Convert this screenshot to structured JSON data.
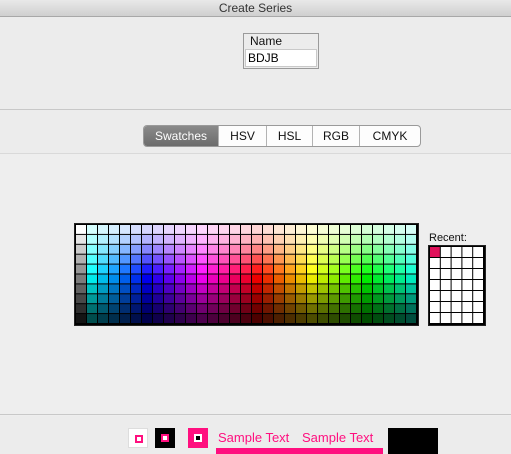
{
  "window": {
    "title": "Create Series"
  },
  "name_field": {
    "legend": "Name",
    "value": "BDJB"
  },
  "tabs": [
    {
      "label": "Swatches",
      "selected": true
    },
    {
      "label": "HSV",
      "selected": false
    },
    {
      "label": "HSL",
      "selected": false
    },
    {
      "label": "RGB",
      "selected": false
    },
    {
      "label": "CMYK",
      "selected": false
    }
  ],
  "swatches": {
    "rows": 10,
    "cols": 31
  },
  "recent": {
    "label": "Recent:",
    "rows": 7,
    "cols": 5,
    "colors": [
      "#e0105a"
    ]
  },
  "preview": {
    "color": "#ff0f7f",
    "samples": [
      "Sample Text",
      "Sample Text"
    ]
  }
}
